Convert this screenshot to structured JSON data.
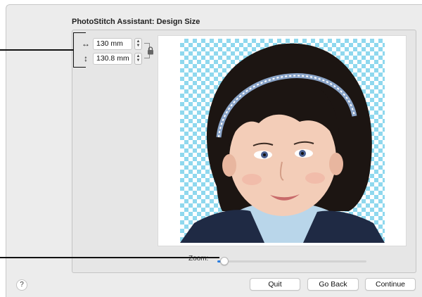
{
  "dialog": {
    "title": "PhotoStitch Assistant: Design Size"
  },
  "size": {
    "width_value": "130 mm",
    "height_value": "130.8 mm",
    "width_icon": "horizontal-arrows-icon",
    "height_icon": "vertical-arrows-icon",
    "lock_icon": "lock-icon"
  },
  "zoom": {
    "label": "Zoom:",
    "level": 0.03
  },
  "buttons": {
    "help": "?",
    "quit": "Quit",
    "go_back": "Go Back",
    "continue": "Continue"
  },
  "colors": {
    "checker_cyan": "#8fd8ee",
    "accent_blue": "#2a7de1"
  }
}
